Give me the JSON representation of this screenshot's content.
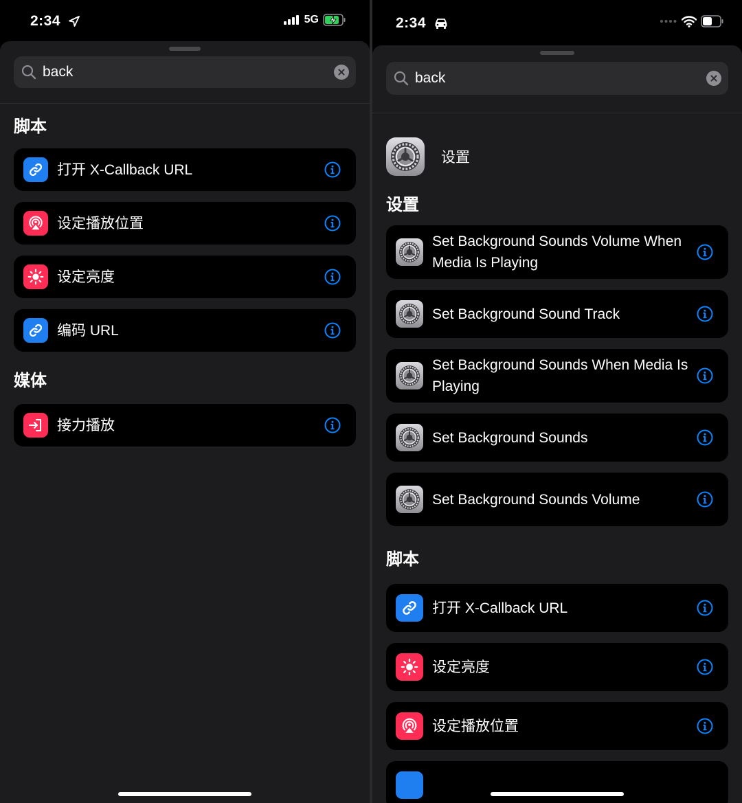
{
  "colors": {
    "accent": "#0a84ff",
    "sheet_bg": "#1c1c1e",
    "card_bg": "#000000",
    "blue_icon": "#1f7ef0",
    "red_icon": "#ff2d55"
  },
  "left": {
    "status": {
      "time": "2:34",
      "network": "5G"
    },
    "search": {
      "value": "back"
    },
    "sections": [
      {
        "title": "脚本",
        "items": [
          {
            "label": "打开 X-Callback URL",
            "icon": "link-icon"
          },
          {
            "label": "设定播放位置",
            "icon": "airplay-audio-icon"
          },
          {
            "label": "设定亮度",
            "icon": "brightness-icon"
          },
          {
            "label": "编码 URL",
            "icon": "link-icon"
          }
        ]
      },
      {
        "title": "媒体",
        "items": [
          {
            "label": "接力播放",
            "icon": "handoff-icon"
          }
        ]
      }
    ]
  },
  "right": {
    "status": {
      "time": "2:34"
    },
    "search": {
      "value": "back"
    },
    "app": {
      "name": "设置",
      "icon": "settings-gear-icon"
    },
    "sections": [
      {
        "title": "设置",
        "items": [
          {
            "label": "Set Background Sounds Volume When Media Is Playing",
            "icon": "settings-gear-icon"
          },
          {
            "label": "Set Background Sound Track",
            "icon": "settings-gear-icon"
          },
          {
            "label": "Set Background Sounds When Media Is Playing",
            "icon": "settings-gear-icon"
          },
          {
            "label": "Set Background Sounds",
            "icon": "settings-gear-icon"
          },
          {
            "label": "Set Background Sounds Volume",
            "icon": "settings-gear-icon"
          }
        ]
      },
      {
        "title": "脚本",
        "items": [
          {
            "label": "打开 X-Callback URL",
            "icon": "link-icon"
          },
          {
            "label": "设定亮度",
            "icon": "brightness-icon"
          },
          {
            "label": "设定播放位置",
            "icon": "airplay-audio-icon"
          }
        ]
      }
    ]
  }
}
